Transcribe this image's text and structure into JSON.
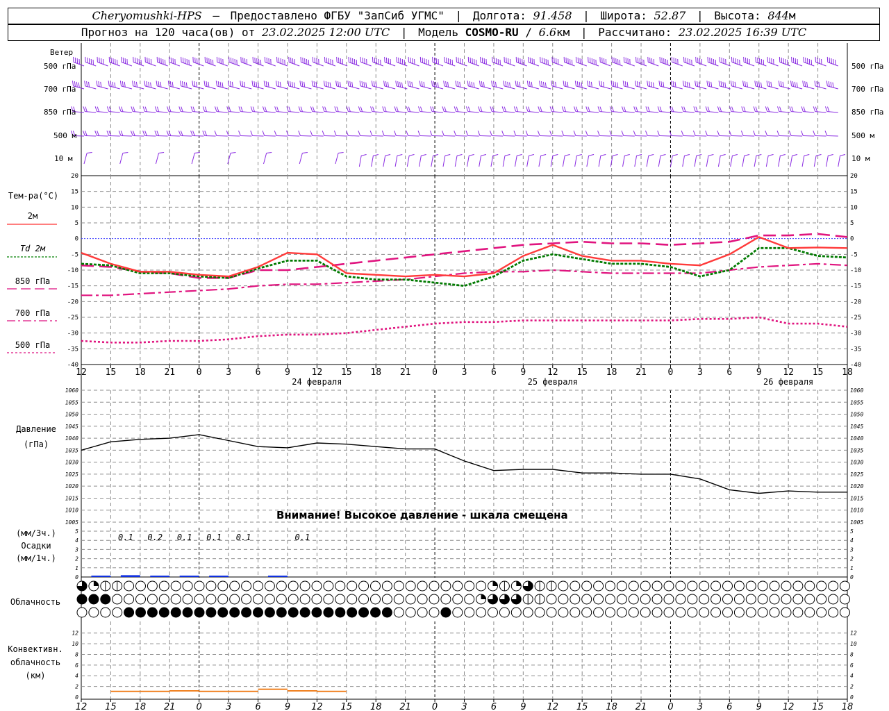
{
  "header": {
    "station": "Cheryomushki-HPS",
    "provider": "Предоставлено ФГБУ \"ЗапСиб УГМС\"",
    "lon_label": "Долгота:",
    "lon_value": "91.458",
    "lat_label": "Широта:",
    "lat_value": "52.87",
    "alt_label": "Высота:",
    "alt_value": "844",
    "alt_unit": "м",
    "forecast_prefix": "Прогноз на 120 часа(ов) от",
    "forecast_time": "23.02.2025 12:00 UTC",
    "model_label": "Модель",
    "model_name": "COSMO-RU",
    "model_res": "6.6",
    "model_res_unit": "км",
    "computed_label": "Рассчитано:",
    "computed_time": "23.02.2025 16:39 UTC"
  },
  "wind": {
    "title": "Ветер",
    "levels": [
      "500 гПа",
      "700 гПа",
      "850 гПа",
      "500 м",
      "10  м"
    ],
    "color": "#8a2be2"
  },
  "temperature": {
    "title": "Тем-ра(°C)",
    "legend": [
      {
        "label": "2м",
        "color": "#ff3030",
        "dash": ""
      },
      {
        "label": "Td  2м",
        "color": "#008000",
        "dash": "3,2"
      },
      {
        "label": "850 гПа",
        "color": "#dd1080",
        "dash": "14,6"
      },
      {
        "label": "700 гПа",
        "color": "#dd1080",
        "dash": "12,4,3,4"
      },
      {
        "label": "500 гПа",
        "color": "#dd1080",
        "dash": "3,3"
      }
    ],
    "yticks": [
      "20",
      "15",
      "10",
      "5",
      "0",
      "-5",
      "-10",
      "-15",
      "-20",
      "-25",
      "-30",
      "-35",
      "-40"
    ]
  },
  "pressure": {
    "title1": "Давление",
    "title2": "(гПа)",
    "yticks": [
      "1060",
      "1055",
      "1050",
      "1045",
      "1040",
      "1035",
      "1030",
      "1025",
      "1020",
      "1015",
      "1010",
      "1005"
    ],
    "warning": "Внимание! Высокое давление - шкала смещена"
  },
  "precip": {
    "label1": "(мм/3ч.)",
    "label2": "Осадки",
    "label3": "(мм/1ч.)",
    "yticks": [
      "5",
      "4",
      "3",
      "2",
      "1",
      "0"
    ],
    "amounts": [
      {
        "x_hour": 6,
        "text": "0.1"
      },
      {
        "x_hour": 9,
        "text": "0.2"
      },
      {
        "x_hour": 12,
        "text": "0.1"
      },
      {
        "x_hour": 15,
        "text": "0.1"
      },
      {
        "x_hour": 18,
        "text": "0.1"
      },
      {
        "x_hour": 24,
        "text": "0.1"
      }
    ]
  },
  "cloud": {
    "title": "Облачность",
    "rows": [
      "3211000000000000000000000000000000021231100000000000000000000000000000000000000000000000000000000000000000000000000000000000000000000000000000000000000",
      "4440000000000000000000000000000000233311000000000000000000000000000000000000000000000000000000000000000000000000000000000000000000000000000000000000000",
      "0000444444444444444444444440000400000000000000000000000000000000000000000000000000000000000000000000000000000000000000000000000000000000000000000000000"
    ]
  },
  "convective": {
    "title1": "Конвективн.",
    "title2": "облачность",
    "title3": "(км)",
    "yticks": [
      "12",
      "10",
      "8",
      "6",
      "4",
      "2",
      "0"
    ]
  },
  "time_axis": {
    "ticks": [
      "12",
      "15",
      "18",
      "21",
      "0",
      "3",
      "6",
      "9",
      "12",
      "15",
      "18",
      "21",
      "0",
      "3",
      "6",
      "9",
      "12",
      "15",
      "18",
      "21",
      "0",
      "3",
      "6",
      "9",
      "12",
      "15",
      "18"
    ],
    "dates": [
      {
        "hour": 24,
        "text": "24 февраля"
      },
      {
        "hour": 48,
        "text": "25 февраля"
      },
      {
        "hour": 72,
        "text": "26 февраля"
      }
    ]
  },
  "chart_data": {
    "type": "line",
    "x_unit": "hours since 23.02.2025 12:00 UTC",
    "x": [
      0,
      3,
      6,
      9,
      12,
      15,
      18,
      21,
      24,
      27,
      30,
      33,
      36,
      39,
      42,
      45,
      48,
      51,
      54,
      57,
      60,
      63,
      66,
      69,
      72,
      75,
      78
    ],
    "temperature_series": [
      {
        "name": "2м",
        "values": [
          -4.5,
          -8,
          -10.5,
          -10.5,
          -11.5,
          -12,
          -9,
          -4.5,
          -5,
          -11,
          -11.5,
          -12,
          -11.5,
          -12,
          -11,
          -5.5,
          -2,
          -5.5,
          -7,
          -7,
          -8,
          -8.5,
          -5,
          0.5,
          -3,
          -2.8,
          -3
        ]
      },
      {
        "name": "Td  2м",
        "values": [
          -8,
          -8.5,
          -11,
          -11,
          -12,
          -12.5,
          -9.5,
          -7,
          -7,
          -12,
          -13,
          -13,
          -14,
          -15,
          -12,
          -7,
          -5,
          -6.5,
          -8,
          -8,
          -9,
          -12,
          -10,
          -3,
          -3,
          -5.5,
          -6
        ]
      },
      {
        "name": "850 гПа",
        "values": [
          -8.5,
          -9,
          -10.5,
          -11,
          -12.5,
          -12.5,
          -10,
          -10,
          -9,
          -8,
          -7,
          -6,
          -5,
          -4,
          -3,
          -2,
          -1.5,
          -1,
          -1.5,
          -1.5,
          -2,
          -1.5,
          -1,
          1,
          1,
          1.5,
          0.5
        ]
      },
      {
        "name": "700 гПа",
        "values": [
          -18,
          -18,
          -17.5,
          -17,
          -16.5,
          -16,
          -15,
          -14.5,
          -14.5,
          -14,
          -13.5,
          -13,
          -12,
          -11,
          -10.5,
          -10.5,
          -10,
          -10.5,
          -11,
          -11,
          -11,
          -11,
          -10,
          -9,
          -8.5,
          -8,
          -8.5
        ]
      },
      {
        "name": "500 гПа",
        "values": [
          -32.5,
          -33,
          -33,
          -32.5,
          -32.5,
          -32,
          -31,
          -30.5,
          -30.5,
          -30,
          -29,
          -28,
          -27,
          -26.5,
          -26.5,
          -26,
          -26,
          -26,
          -26,
          -26,
          -26,
          -25.5,
          -25.5,
          -25,
          -27,
          -27,
          -28
        ]
      }
    ],
    "temperature_ylim": [
      -40,
      20
    ],
    "pressure": {
      "name": "Давление",
      "values": [
        1035,
        1038.5,
        1039.5,
        1040,
        1041.5,
        1039,
        1036.5,
        1036,
        1038,
        1037.5,
        1036.5,
        1035.5,
        1035.5,
        1030.5,
        1026.5,
        1027,
        1027,
        1025.5,
        1025.5,
        1025,
        1025,
        1023,
        1018.5,
        1017,
        1018,
        1017.5,
        1017.5
      ]
    },
    "pressure_ylim": [
      1005,
      1060
    ],
    "precip_mm_3h": [
      0,
      0.1,
      0.2,
      0.1,
      0.1,
      0.1,
      0,
      0.1,
      0,
      0,
      0,
      0,
      0,
      0,
      0,
      0,
      0,
      0,
      0,
      0,
      0,
      0,
      0,
      0,
      0,
      0,
      0
    ],
    "convective_km": [
      0,
      1.2,
      1.2,
      1.3,
      1.2,
      1.2,
      1.6,
      1.3,
      1.2,
      0,
      0,
      0,
      0,
      0,
      0,
      0,
      0,
      0,
      0,
      0,
      0,
      0,
      0,
      0,
      0,
      0,
      0
    ],
    "xlabel": "",
    "grid": true
  }
}
